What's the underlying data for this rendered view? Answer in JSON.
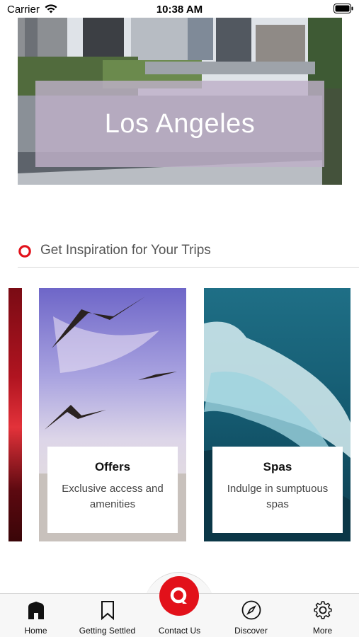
{
  "status_bar": {
    "carrier": "Carrier",
    "time": "10:38 AM",
    "icons": [
      "wifi-icon",
      "battery-icon"
    ]
  },
  "hero": {
    "title": "Los Angeles"
  },
  "inspiration": {
    "title": "Get Inspiration for Your Trips",
    "icon": "ring-icon",
    "accent_color": "#e2111a",
    "cards": [
      {
        "title": "Offers",
        "description": "Exclusive access and amenities"
      },
      {
        "title": "Spas",
        "description": "Indulge in sumptuous spas"
      }
    ]
  },
  "tab_bar": {
    "items": [
      {
        "label": "Home",
        "icon": "home-icon",
        "active": true
      },
      {
        "label": "Getting Settled",
        "icon": "bookmark-icon",
        "active": false
      },
      {
        "label": "Contact Us",
        "icon": "chat-icon",
        "active": false
      },
      {
        "label": "Discover",
        "icon": "compass-icon",
        "active": false
      },
      {
        "label": "More",
        "icon": "gear-icon",
        "active": false
      }
    ],
    "accent_color": "#e2111a"
  }
}
